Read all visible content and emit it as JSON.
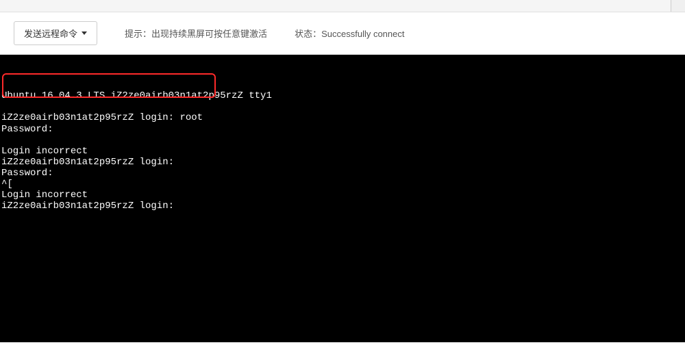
{
  "toolbar": {
    "send_remote_label": "发送远程命令",
    "hint_label": "提示",
    "hint_value": "出现持续黑屏可按任意键激活",
    "status_label": "状态",
    "status_value": "Successfully connect"
  },
  "terminal": {
    "lines": [
      "",
      "Ubuntu 16.04.3 LTS iZ2ze0airb03n1at2p95rzZ tty1",
      "",
      "iZ2ze0airb03n1at2p95rzZ login: root",
      "Password:",
      "",
      "Login incorrect",
      "iZ2ze0airb03n1at2p95rzZ login:",
      "Password:",
      "^[",
      "Login incorrect",
      "iZ2ze0airb03n1at2p95rzZ login:"
    ]
  }
}
